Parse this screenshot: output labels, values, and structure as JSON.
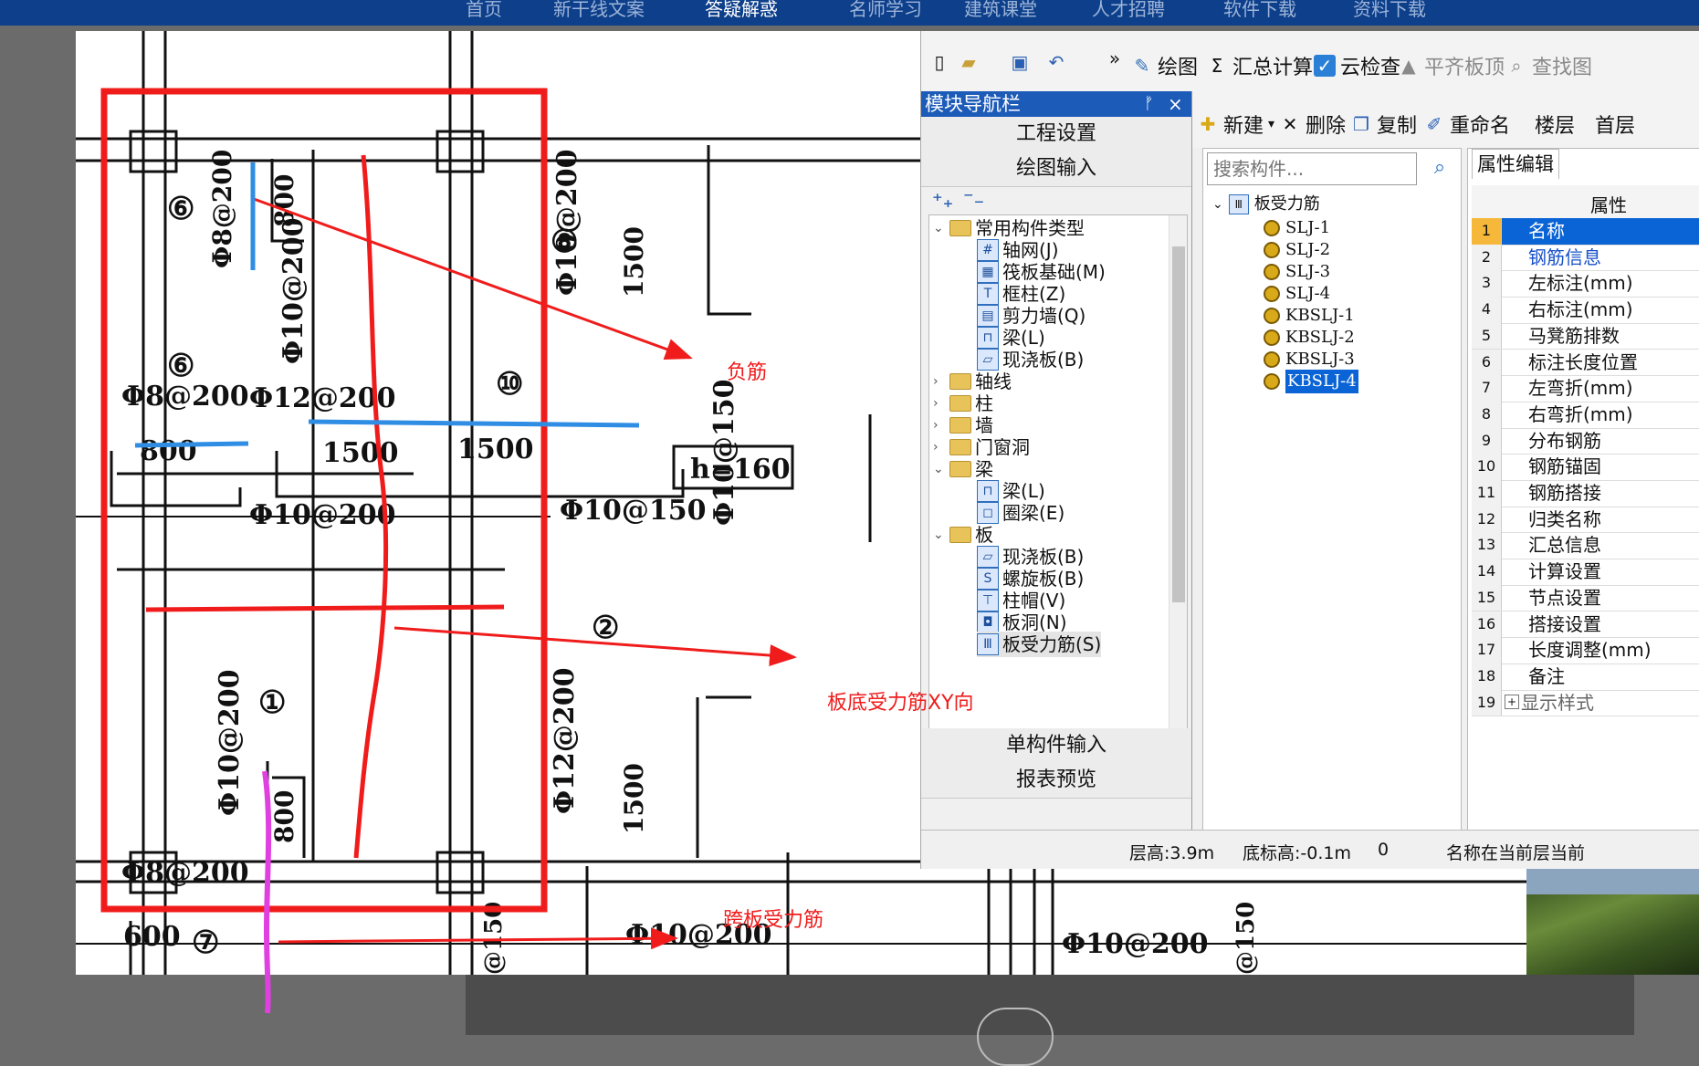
{
  "top_nav": {
    "items": [
      "首页",
      "新干线文案",
      "答疑解惑",
      "名师学习",
      "建筑课堂",
      "人才招聘",
      "软件下载",
      "资料下载"
    ]
  },
  "drawing": {
    "labels": {
      "circle_6a": "⑥",
      "circle_6b": "⑥",
      "circle_8": "⑧",
      "circle_10": "⑩",
      "circle_1": "①",
      "circle_2": "②",
      "circle_7": "⑦",
      "rebar_v1": "Φ8@200",
      "rebar_v2": "Φ10@200",
      "rebar_v3": "Φ10@200",
      "rebar_v4": "Φ10@150",
      "rebar_v5": "Φ12@200",
      "rebar_8": "Φ10@200",
      "rebar_h1": "Φ8@200",
      "rebar_h2": "Φ12@200",
      "rebar_h3": "Φ10@200",
      "rebar_h4": "Φ10@150",
      "rebar_h5": "Φ8@200",
      "rebar_h6": "Φ10@200",
      "rebar_h7": "Φ10@200",
      "dim_800a": "800",
      "dim_800b": "800",
      "dim_800c": "800",
      "dim_1500a": "1500",
      "dim_1500b": "1500",
      "dim_1500c": "1500",
      "dim_1500d": "1500",
      "dim_600": "600",
      "thickness": "h=160",
      "cut1": "@150",
      "cut2": "@150"
    }
  },
  "annotations": {
    "neg": "负筋",
    "bottom": "板底受力筋XY向",
    "span": "跨板受力筋"
  },
  "app": {
    "toolbar1": {
      "draw": "绘图",
      "sum": "汇总计算",
      "cloud": "云检查",
      "align": "平齐板顶",
      "find": "查找图"
    },
    "toolbar2": {
      "new": "新建",
      "delete": "删除",
      "copy": "复制",
      "rename": "重命名",
      "floor_label": "楼层",
      "floor_value": "首层"
    },
    "nav": {
      "title": "模块导航栏",
      "sections": [
        "工程设置",
        "绘图输入",
        "单构件输入",
        "报表预览"
      ],
      "tree": [
        "常用构件类型",
        "轴网(J)",
        "筏板基础(M)",
        "框柱(Z)",
        "剪力墙(Q)",
        "梁(L)",
        "现浇板(B)",
        "轴线",
        "柱",
        "墙",
        "门窗洞",
        "梁",
        "梁(L)",
        "圈梁(E)",
        "板",
        "现浇板(B)",
        "螺旋板(B)",
        "柱帽(V)",
        "板洞(N)",
        "板受力筋(S)"
      ]
    },
    "components": {
      "search_placeholder": "搜索构件...",
      "root": "板受力筋",
      "items": [
        "SLJ-1",
        "SLJ-2",
        "SLJ-3",
        "SLJ-4",
        "KBSLJ-1",
        "KBSLJ-2",
        "KBSLJ-3",
        "KBSLJ-4"
      ]
    },
    "props": {
      "tab": "属性编辑",
      "header": "属性",
      "rows": [
        "名称",
        "钢筋信息",
        "左标注(mm)",
        "右标注(mm)",
        "马凳筋排数",
        "标注长度位置",
        "左弯折(mm)",
        "右弯折(mm)",
        "分布钢筋",
        "钢筋锚固",
        "钢筋搭接",
        "归类名称",
        "汇总信息",
        "计算设置",
        "节点设置",
        "搭接设置",
        "长度调整(mm)",
        "备注",
        "显示样式"
      ],
      "row_numbers": [
        "1",
        "2",
        "3",
        "4",
        "5",
        "6",
        "7",
        "8",
        "9",
        "10",
        "11",
        "12",
        "13",
        "14",
        "15",
        "16",
        "17",
        "18",
        "19"
      ]
    },
    "status": {
      "floor_height": "层高:3.9m",
      "bottom_elev": "底标高:-0.1m",
      "zero": "0",
      "name_hint": "名称在当前层当前"
    }
  },
  "colors": {
    "nav_blue": "#0d3f8a",
    "app_title_blue": "#1c5bb8",
    "annot_red": "#f01c1c",
    "annot_blue": "#2f8de4",
    "annot_magenta": "#e040e0"
  }
}
